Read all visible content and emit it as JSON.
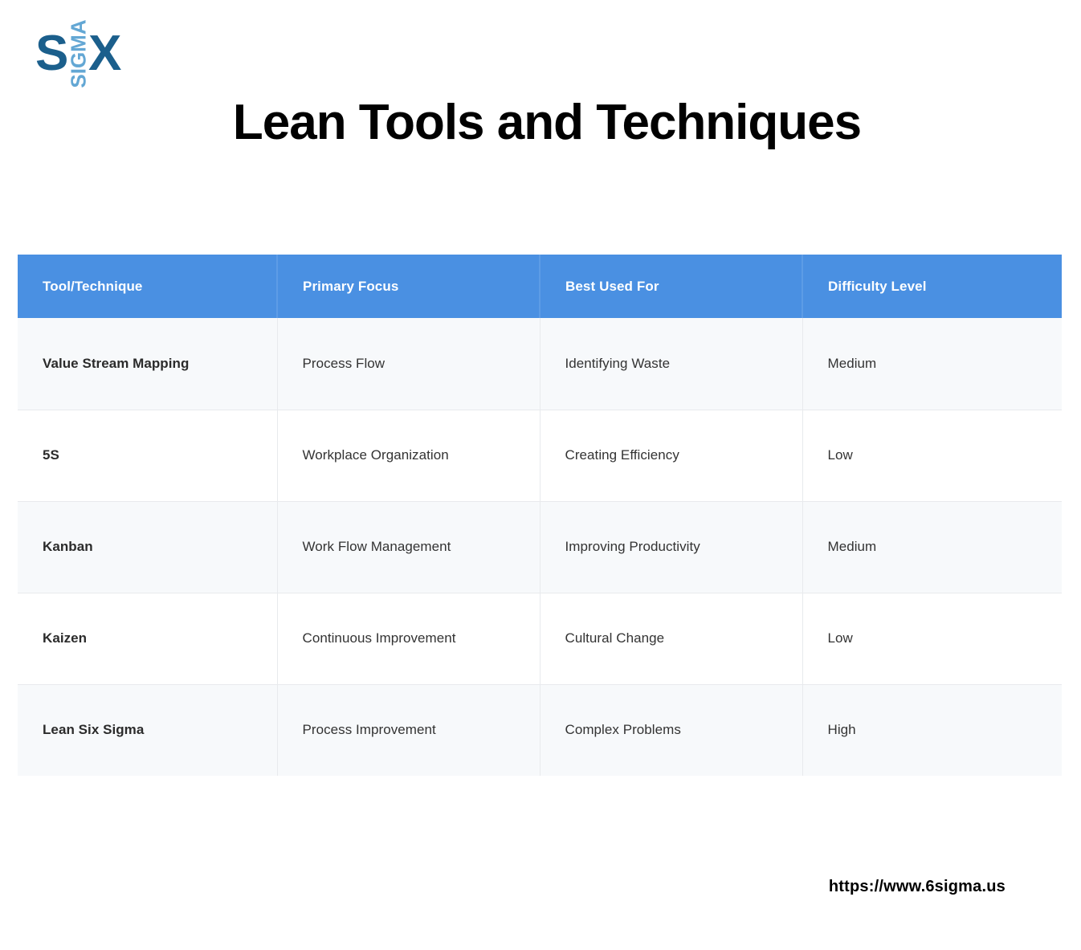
{
  "logo": {
    "letter_left": "S",
    "letter_right": "X",
    "word_vertical": "SIGMA",
    "color_dark": "#1b5f8c",
    "color_light": "#63a7d4"
  },
  "title": "Lean Tools and Techniques",
  "table": {
    "header_bg": "#4a90e2",
    "header_text_color": "#ffffff",
    "row_alt_bg": "#f7f9fb",
    "row_plain_bg": "#ffffff",
    "columns": [
      "Tool/Technique",
      "Primary Focus",
      "Best Used For",
      "Difficulty Level"
    ],
    "rows": [
      {
        "tool": "Value Stream Mapping",
        "focus": "Process Flow",
        "best_used_for": "Identifying Waste",
        "difficulty": "Medium"
      },
      {
        "tool": "5S",
        "focus": "Workplace Organization",
        "best_used_for": "Creating Efficiency",
        "difficulty": "Low"
      },
      {
        "tool": "Kanban",
        "focus": "Work Flow Management",
        "best_used_for": "Improving Productivity",
        "difficulty": "Medium"
      },
      {
        "tool": "Kaizen",
        "focus": "Continuous Improvement",
        "best_used_for": "Cultural Change",
        "difficulty": "Low"
      },
      {
        "tool": "Lean Six Sigma",
        "focus": "Process Improvement",
        "best_used_for": "Complex Problems",
        "difficulty": "High"
      }
    ]
  },
  "footer": {
    "url": "https://www.6sigma.us"
  }
}
